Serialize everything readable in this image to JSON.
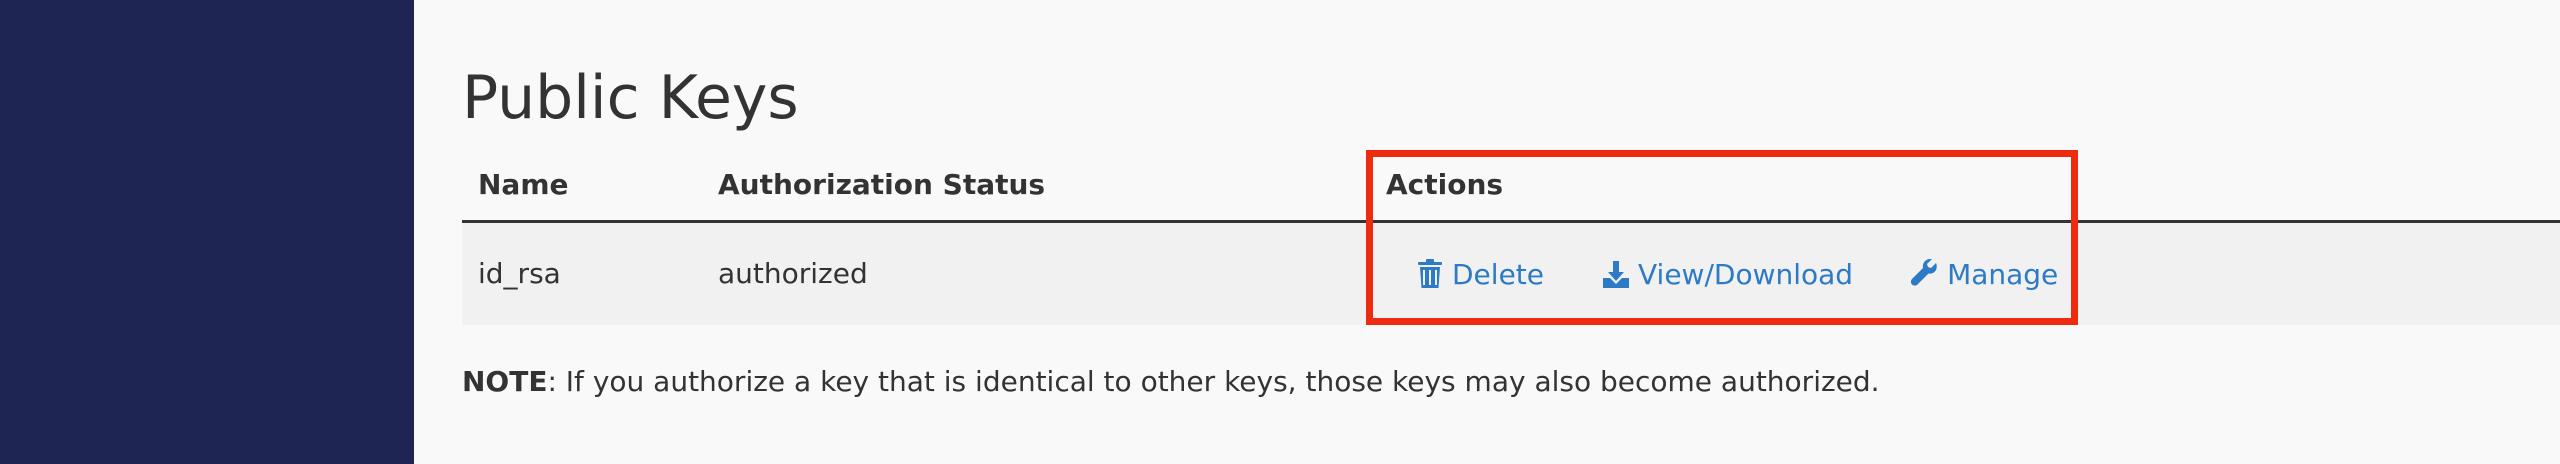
{
  "sidebar": {
    "color": "#1f2552"
  },
  "page": {
    "title": "Public Keys"
  },
  "table": {
    "headers": {
      "name": "Name",
      "status": "Authorization Status",
      "actions": "Actions"
    },
    "rows": [
      {
        "name": "id_rsa",
        "status": "authorized",
        "actions": {
          "delete": {
            "label": "Delete",
            "icon": "trash-icon"
          },
          "view": {
            "label": "View/Download",
            "icon": "download-icon"
          },
          "manage": {
            "label": "Manage",
            "icon": "wrench-icon"
          }
        }
      }
    ]
  },
  "note": {
    "label": "NOTE",
    "text": ": If you authorize a key that is identical to other keys, those keys may also become authorized."
  },
  "colors": {
    "link": "#2d7ac5",
    "highlight": "#ee2a0f",
    "text": "#333333"
  }
}
